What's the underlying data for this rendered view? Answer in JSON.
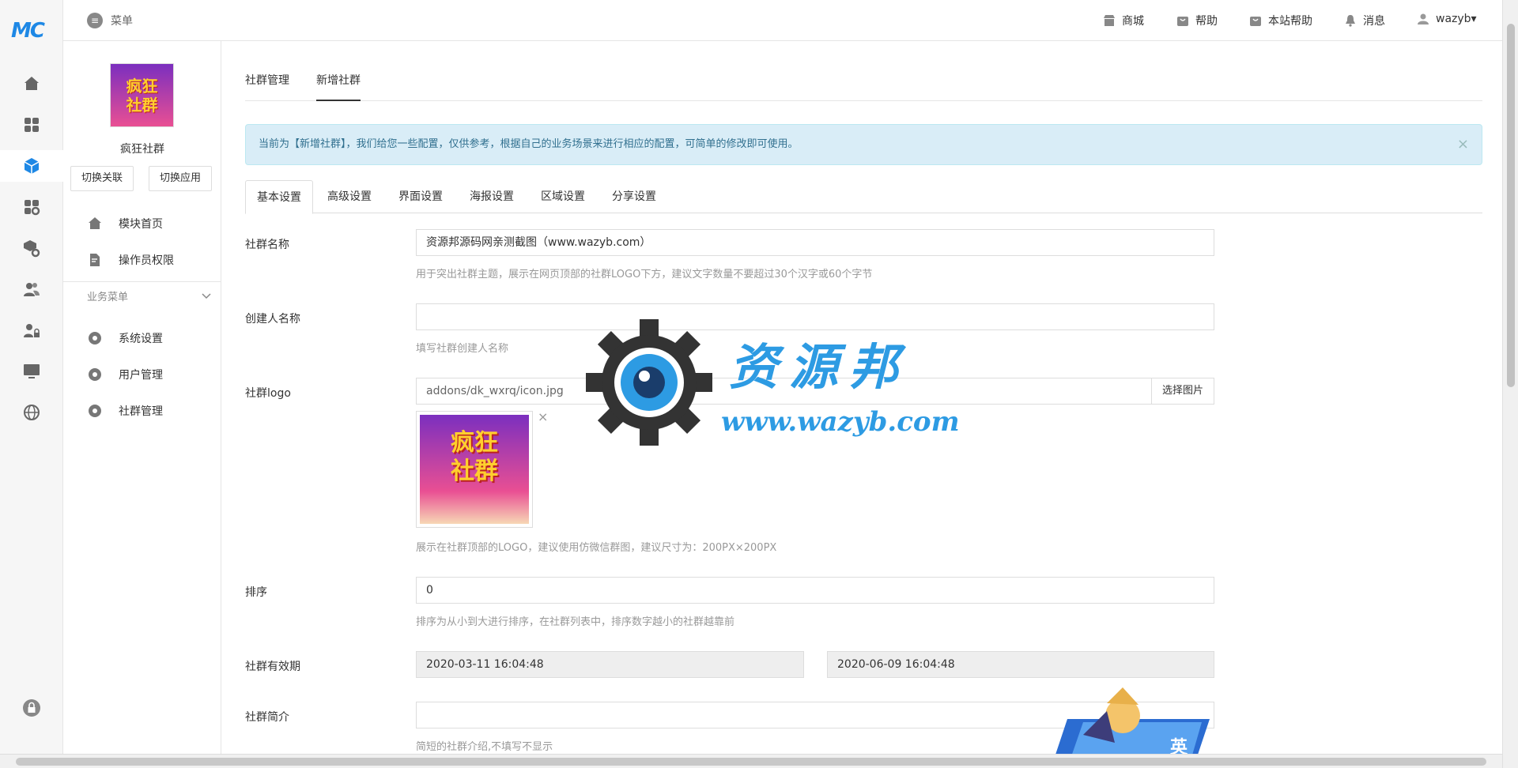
{
  "rail": {
    "logo": "MC",
    "icons": [
      "home-icon",
      "apps-icon",
      "cube-icon",
      "grid-gear-icon",
      "box-gear-icon",
      "users-icon",
      "user-lock-icon",
      "monitor-icon",
      "globe-icon",
      "lock-icon"
    ]
  },
  "topbar": {
    "menu_label": "菜单",
    "links": {
      "shop": "商城",
      "help": "帮助",
      "site_help": "本站帮助",
      "messages": "消息",
      "user": "wazyb▾"
    }
  },
  "sidebar": {
    "app_logo_line1": "疯狂",
    "app_logo_line2": "社群",
    "app_name": "疯狂社群",
    "switch_link": "切换关联",
    "switch_app": "切换应用",
    "items": [
      {
        "label": "模块首页"
      },
      {
        "label": "操作员权限"
      }
    ],
    "group_title": "业务菜单",
    "group_items": [
      {
        "label": "系统设置"
      },
      {
        "label": "用户管理"
      },
      {
        "label": "社群管理"
      }
    ]
  },
  "page_tabs": [
    "社群管理",
    "新增社群"
  ],
  "alert": "当前为【新增社群】，我们给您一些配置，仅供参考，根据自己的业务场景来进行相应的配置，可简单的修改即可使用。",
  "alert_close": "×",
  "form_tabs": [
    "基本设置",
    "高级设置",
    "界面设置",
    "海报设置",
    "区域设置",
    "分享设置"
  ],
  "form": {
    "name": {
      "label": "社群名称",
      "value": "资源邦源码网亲测截图（www.wazyb.com）",
      "help": "用于突出社群主题，展示在网页顶部的社群LOGO下方，建议文字数量不要超过30个汉字或60个字节"
    },
    "creator": {
      "label": "创建人名称",
      "value": "",
      "help": "填写社群创建人名称"
    },
    "logo": {
      "label": "社群logo",
      "value": "addons/dk_wxrq/icon.jpg",
      "button": "选择图片",
      "remove": "×",
      "help": "展示在社群顶部的LOGO，建议使用仿微信群图，建议尺寸为：200PX×200PX"
    },
    "sort": {
      "label": "排序",
      "value": "0",
      "help": "排序为从小到大进行排序，在社群列表中，排序数字越小的社群越靠前"
    },
    "validity": {
      "label": "社群有效期",
      "start": "2020-03-11 16:04:48",
      "end": "2020-06-09 16:04:48"
    },
    "intro": {
      "label": "社群简介",
      "value": "",
      "help": "简短的社群介绍,不填写不显示"
    }
  },
  "watermark": {
    "cn": "资源邦",
    "url": "www.wazyb.com"
  },
  "hero_text": "英"
}
